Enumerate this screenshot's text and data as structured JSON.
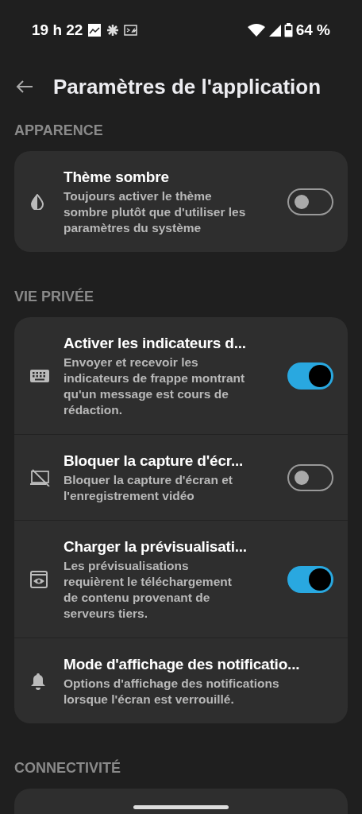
{
  "status_bar": {
    "time": "19 h 22",
    "battery": "64 %"
  },
  "header": {
    "title": "Paramètres de l'application"
  },
  "sections": [
    {
      "title": "APPARENCE",
      "items": [
        {
          "kind": "toggle",
          "title": "Thème sombre",
          "description": "Toujours activer le thème sombre plutôt que d'utiliser les paramètres du système",
          "on": false
        }
      ]
    },
    {
      "title": "VIE PRIVÉE",
      "items": [
        {
          "kind": "toggle",
          "title": "Activer les indicateurs d...",
          "description": "Envoyer et recevoir les indicateurs de frappe montrant qu'un message est cours de rédaction.",
          "on": true
        },
        {
          "kind": "toggle",
          "title": "Bloquer la capture d'écr...",
          "description": "Bloquer la capture d'écran et l'enregistrement vidéo",
          "on": false
        },
        {
          "kind": "toggle",
          "title": "Charger la prévisualisati...",
          "description": "Les prévisualisations requièrent le téléchargement de contenu provenant de serveurs tiers.",
          "on": true
        },
        {
          "kind": "link",
          "title": "Mode d'affichage des notificatio...",
          "description": "Options d'affichage des notifications lorsque l'écran est verrouillé."
        }
      ]
    },
    {
      "title": "CONNECTIVITÉ"
    }
  ]
}
